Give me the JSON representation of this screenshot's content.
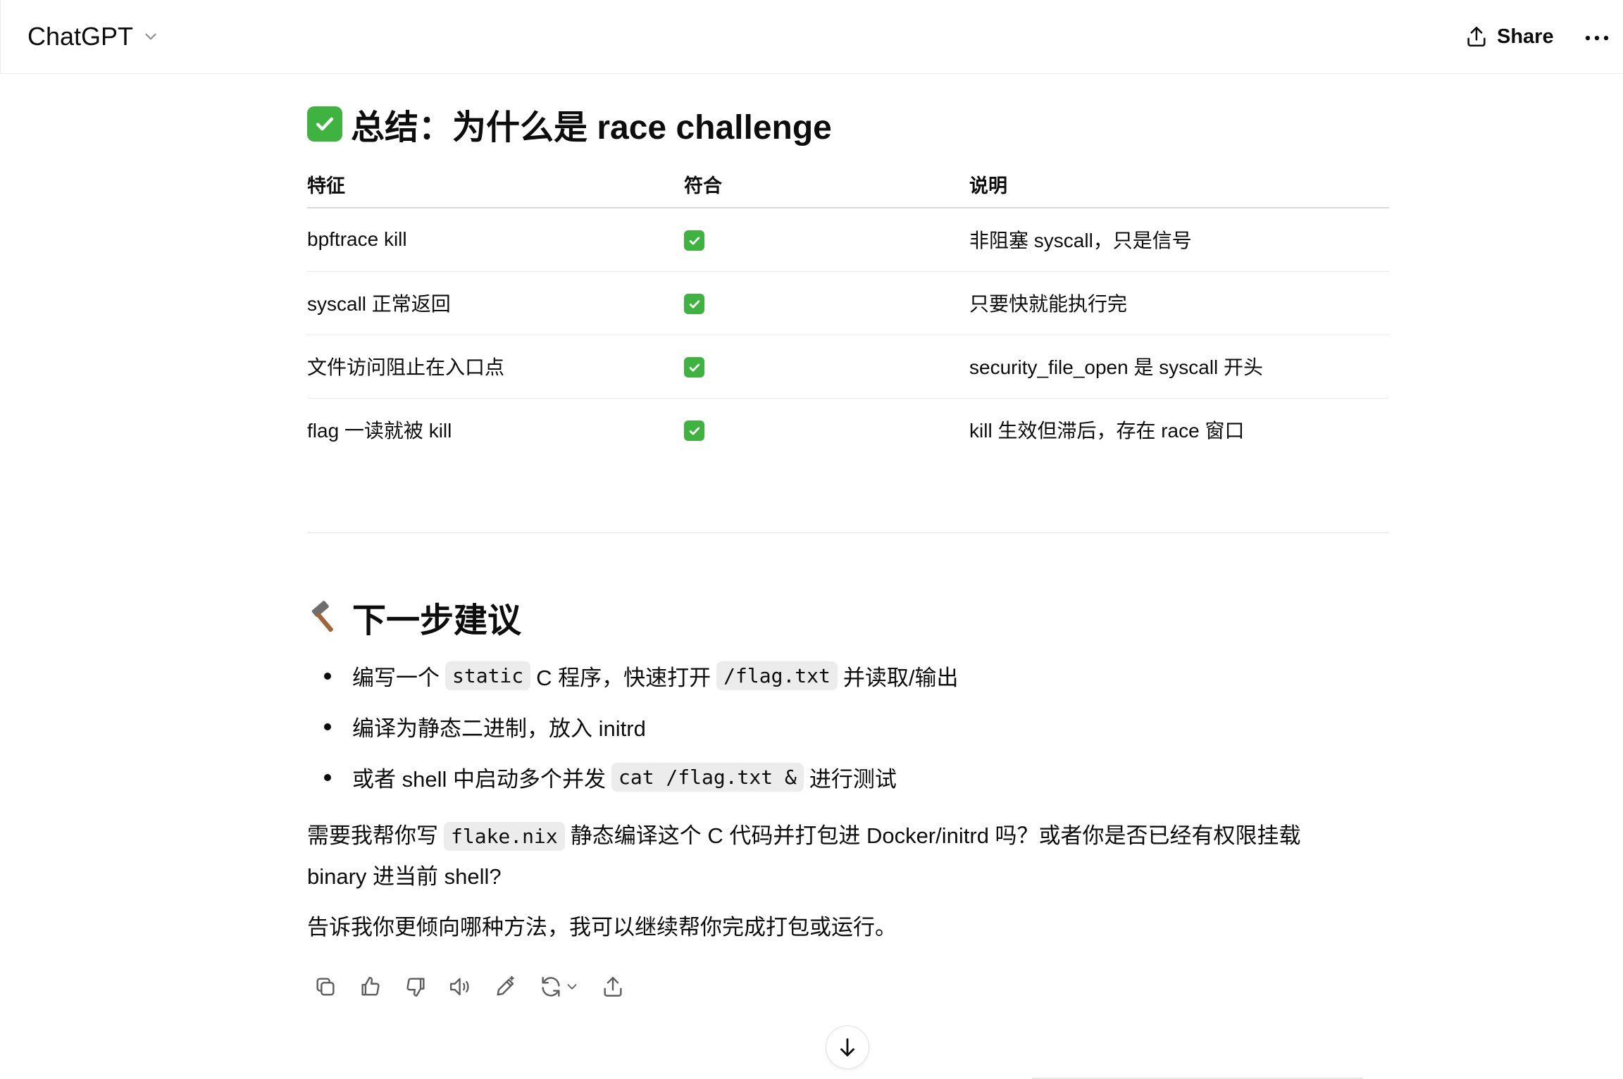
{
  "header": {
    "model_title": "ChatGPT",
    "share_label": "Share"
  },
  "summary": {
    "heading": "总结：为什么是 race challenge",
    "columns": [
      "特征",
      "符合",
      "说明"
    ],
    "rows": [
      {
        "feature": "bpftrace kill",
        "match": "✅",
        "note": "非阻塞 syscall，只是信号"
      },
      {
        "feature": "syscall 正常返回",
        "match": "✅",
        "note": "只要快就能执行完"
      },
      {
        "feature": "文件访问阻止在入口点",
        "match": "✅",
        "note": "security_file_open 是 syscall 开头"
      },
      {
        "feature": "flag 一读就被 kill",
        "match": "✅",
        "note": "kill 生效但滞后，存在 race 窗口"
      }
    ]
  },
  "next_steps": {
    "heading": "下一步建议",
    "items": [
      {
        "a": "编写一个",
        "code1": "static",
        "b": "C 程序，快速打开",
        "code2": "/flag.txt",
        "c": "并读取/输出"
      },
      {
        "a": "编译为静态二进制，放入 initrd"
      },
      {
        "a": "或者 shell 中启动多个并发",
        "code1": "cat /flag.txt &",
        "b": "进行测试"
      }
    ]
  },
  "paragraph1": {
    "a": "需要我帮你写",
    "code": "flake.nix",
    "b": "静态编译这个 C 代码并打包进 Docker/initrd 吗？或者你是否已经有权限挂载",
    "c": "binary 进当前 shell?"
  },
  "paragraph2": "告诉我你更倾向哪种方法，我可以继续帮你完成打包或运行。",
  "icons": {
    "copy": "copy-icon",
    "like": "thumbs-up-icon",
    "dislike": "thumbs-down-icon",
    "read_aloud": "speaker-icon",
    "edit": "edit-icon",
    "regenerate": "regenerate-icon",
    "share": "share-icon",
    "scroll": "arrow-down-icon"
  },
  "colors": {
    "check_green": "#3fb33f",
    "text": "#0d0d0d",
    "code_bg": "#ececec"
  }
}
